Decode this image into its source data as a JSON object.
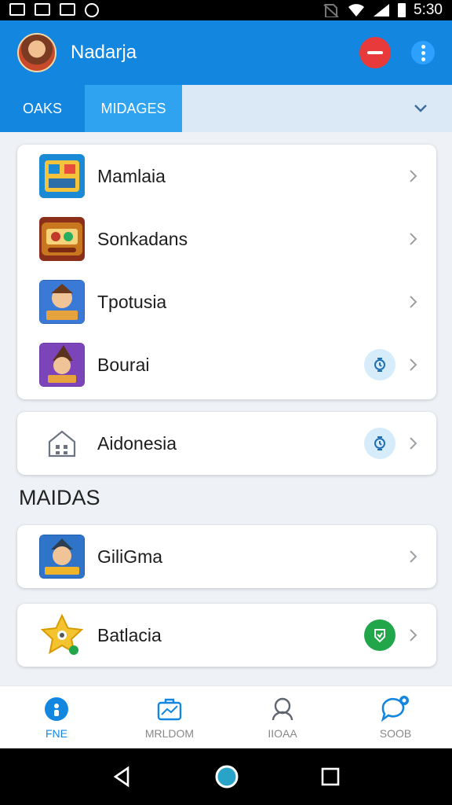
{
  "status_bar": {
    "time": "5:30"
  },
  "app_bar": {
    "title": "Nadarja"
  },
  "tabs": [
    {
      "label": "OAKS"
    },
    {
      "label": "MIDAGES"
    }
  ],
  "list_group_1": [
    {
      "label": "Mamlaia",
      "icon": "puzzle-game-icon"
    },
    {
      "label": "Sonkadans",
      "icon": "slots-game-icon"
    },
    {
      "label": "Tpotusia",
      "icon": "adventure-game-icon"
    },
    {
      "label": "Bourai",
      "icon": "wizard-game-icon"
    }
  ],
  "list_group_2": [
    {
      "label": "Aidonesia",
      "icon": "building-icon"
    }
  ],
  "section_heading": "MAIDAS",
  "list_group_3": [
    {
      "label": "GiliGma",
      "icon": "character-game-icon"
    },
    {
      "label": "Batlacia",
      "icon": "star-icon"
    }
  ],
  "bottom_nav": [
    {
      "label": "FNE",
      "icon": "home-badge-icon"
    },
    {
      "label": "MRLDOM",
      "icon": "briefcase-icon"
    },
    {
      "label": "IIOAA",
      "icon": "profile-icon"
    },
    {
      "label": "SOOB",
      "icon": "chat-icon"
    }
  ],
  "colors": {
    "primary": "#1386e0",
    "accent_red": "#e83a3a",
    "accent_green": "#22a64a"
  }
}
